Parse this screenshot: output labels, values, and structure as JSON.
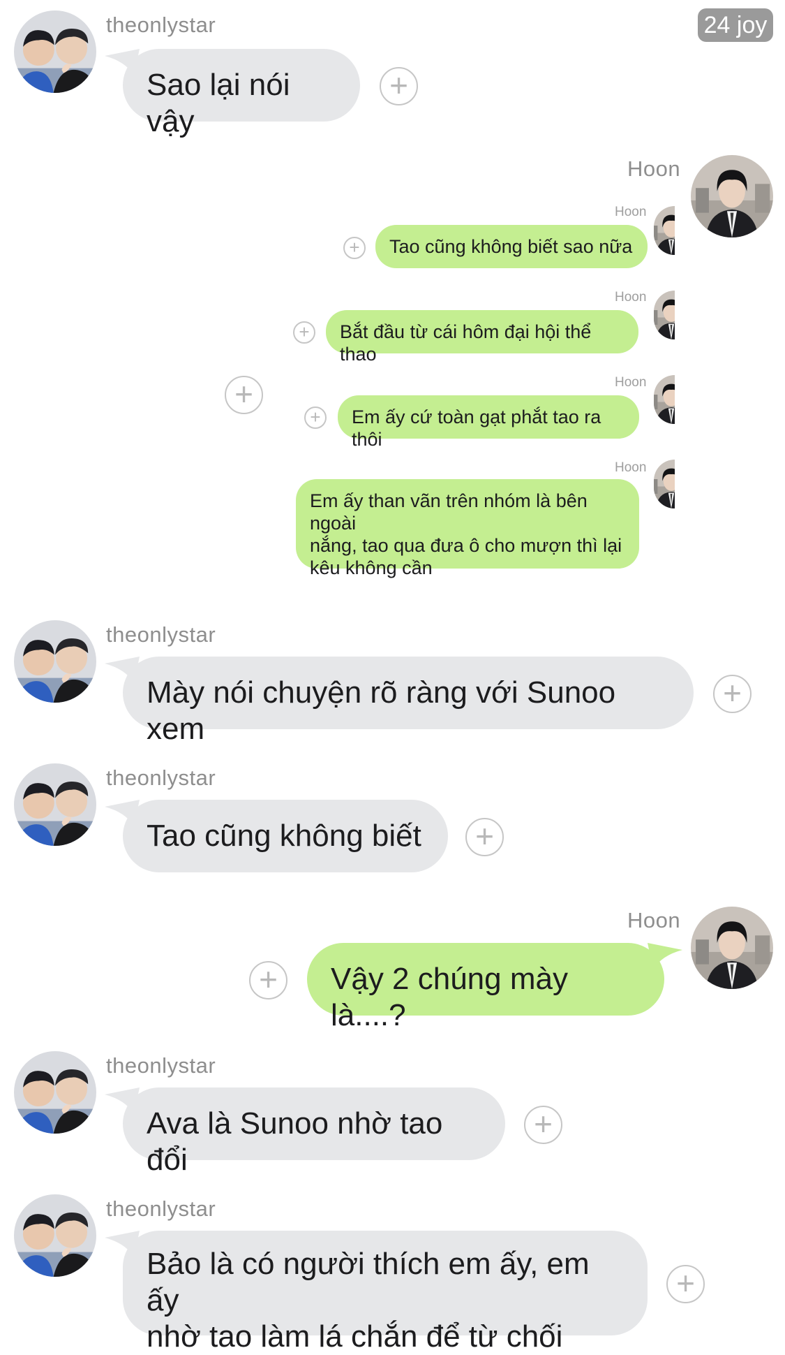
{
  "corner_badge": "24 joy",
  "messages": [
    {
      "sender": "theonlystar",
      "text": "Sao lại nói vậy"
    },
    {
      "sender": "Hoon",
      "quoted": [
        {
          "sender": "Hoon",
          "text": "Tao cũng không biết sao nữa"
        },
        {
          "sender": "Hoon",
          "text": "Bắt đầu từ cái hôm đại hội thể thao"
        },
        {
          "sender": "Hoon",
          "text": "Em ấy cứ toàn gạt phắt tao ra thôi"
        },
        {
          "sender": "Hoon",
          "text": "Em ấy than vãn trên nhóm là bên ngoài\nnắng, tao qua đưa ô cho mượn thì lại\nkêu không cần"
        }
      ]
    },
    {
      "sender": "theonlystar",
      "text": "Mày nói chuyện rõ ràng với Sunoo xem"
    },
    {
      "sender": "theonlystar",
      "text": "Tao cũng không biết"
    },
    {
      "sender": "Hoon",
      "text": "Vậy 2 chúng mày là....?"
    },
    {
      "sender": "theonlystar",
      "text": "Ava là Sunoo nhờ tao đổi"
    },
    {
      "sender": "theonlystar",
      "text": "Bảo là có người thích em ấy, em ấy\nnhờ tao làm lá chắn để từ chối"
    }
  ],
  "icons": {
    "react": "plus-circle-icon",
    "avatar_theonlystar": "avatar-theonlystar",
    "avatar_hoon": "avatar-hoon"
  },
  "colors": {
    "incoming_bubble": "#e6e7e9",
    "outgoing_bubble": "#c4ee91",
    "badge": "#9a9a9a"
  }
}
